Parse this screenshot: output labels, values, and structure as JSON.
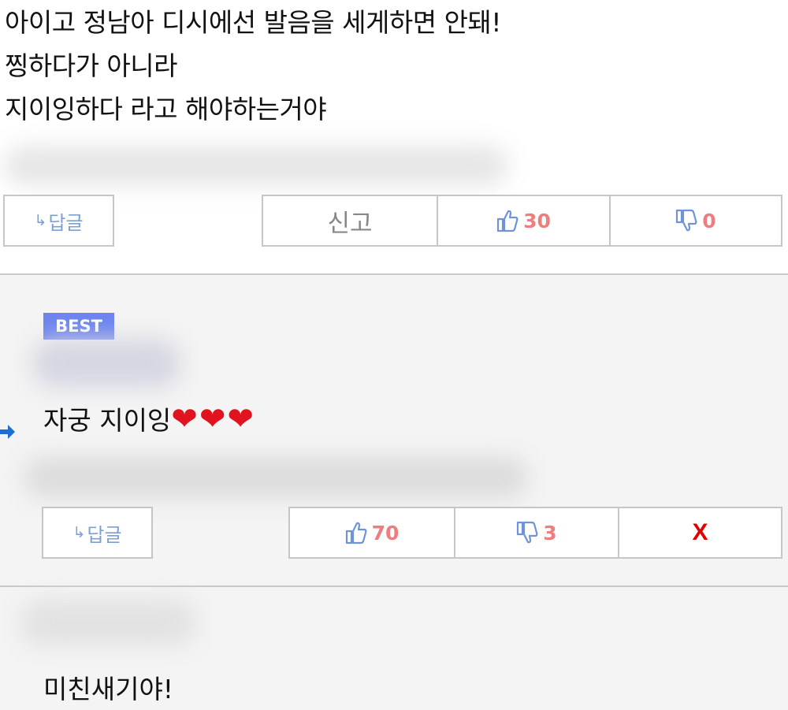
{
  "comment1": {
    "lines": [
      "아이고 정남아 디시에선 발음을 세게하면 안돼!",
      "찡하다가 아니라",
      "지이잉하다 라고 해야하는거야"
    ],
    "reply_label": "답글",
    "report_label": "신고",
    "upvotes": "30",
    "downvotes": "0"
  },
  "comment2": {
    "badge": "BEST",
    "text": "자궁 지이잉",
    "hearts": "❤❤❤",
    "reply_label": "답글",
    "upvotes": "70",
    "downvotes": "3",
    "delete_label": "X"
  },
  "comment3": {
    "text": "미친새기야!"
  },
  "colors": {
    "badge": "#6d84f0",
    "count": "#ee7d80",
    "reply": "#7e9fd4",
    "heart": "#e0131f",
    "delete": "#e00000"
  },
  "icons": [
    "reply-arrow-icon",
    "thumbs-up-icon",
    "thumbs-down-icon",
    "best-reply-arrow-icon"
  ]
}
